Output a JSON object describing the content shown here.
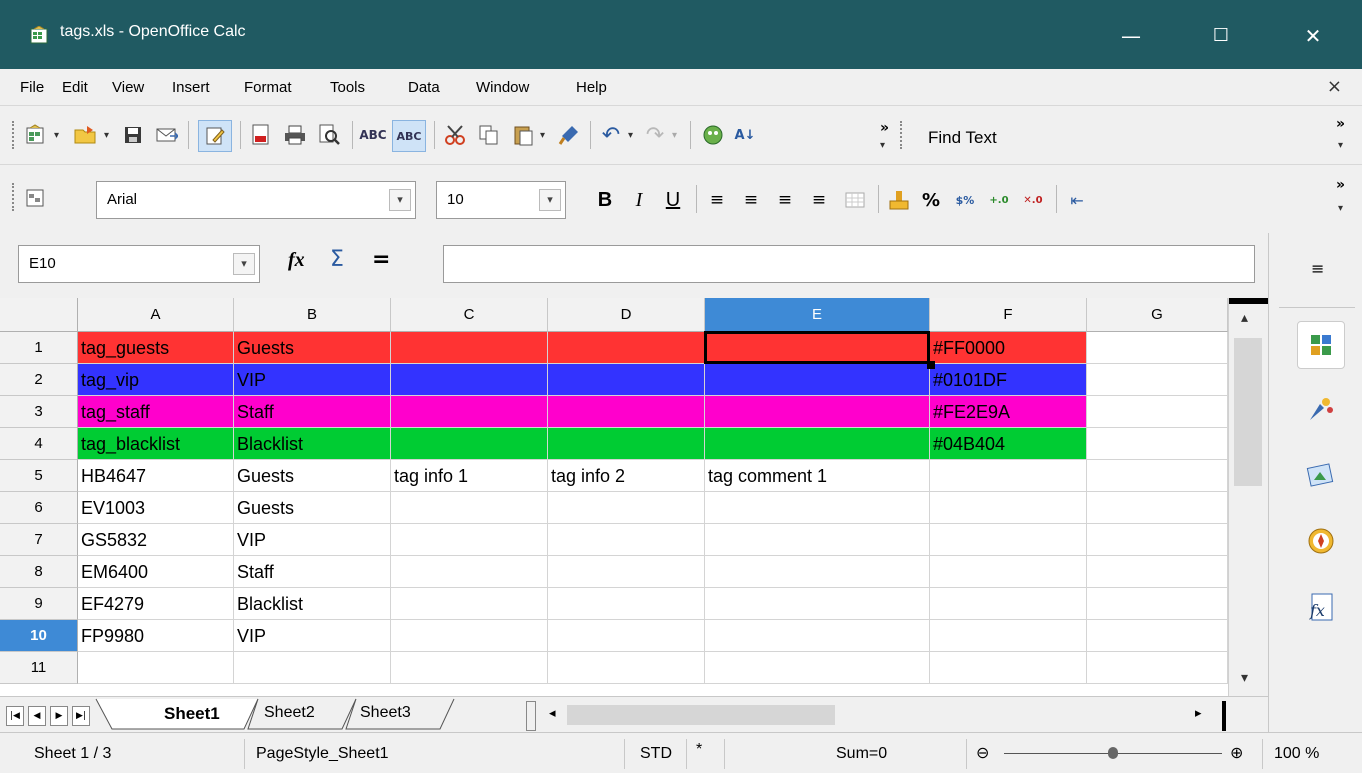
{
  "window": {
    "title": "tags.xls - OpenOffice Calc",
    "minimize": "—",
    "maximize": "☐",
    "close": "✕"
  },
  "menu": {
    "items": [
      "File",
      "Edit",
      "View",
      "Insert",
      "Format",
      "Tools",
      "Data",
      "Window",
      "Help"
    ],
    "close_doc": "×"
  },
  "toolbar": {
    "find_text": "Find Text",
    "more": "»"
  },
  "format": {
    "font_name": "Arial",
    "font_size": "10",
    "bold": "B",
    "italic": "I",
    "underline": "U",
    "percent": "%"
  },
  "formula": {
    "cell_ref": "E10",
    "fx": "fx",
    "sum": "Σ",
    "equals": "=",
    "content": ""
  },
  "grid": {
    "columns": [
      "A",
      "B",
      "C",
      "D",
      "E",
      "F",
      "G"
    ],
    "selected_column": "E",
    "rows": [
      {
        "num": "1",
        "fill": "#FF3333",
        "cells": [
          "tag_guests",
          "Guests",
          "",
          "",
          "",
          "#FF0000",
          ""
        ]
      },
      {
        "num": "2",
        "fill": "#3333FF",
        "cells": [
          "tag_vip",
          "VIP",
          "",
          "",
          "",
          "#0101DF",
          ""
        ]
      },
      {
        "num": "3",
        "fill": "#FF00CC",
        "cells": [
          "tag_staff",
          "Staff",
          "",
          "",
          "",
          "#FE2E9A",
          ""
        ]
      },
      {
        "num": "4",
        "fill": "#00CC33",
        "cells": [
          "tag_blacklist",
          "Blacklist",
          "",
          "",
          "",
          "#04B404",
          ""
        ]
      },
      {
        "num": "5",
        "fill": "",
        "cells": [
          "HB4647",
          "Guests",
          "tag info 1",
          "tag info 2",
          "tag comment 1",
          "",
          ""
        ]
      },
      {
        "num": "6",
        "fill": "",
        "cells": [
          "EV1003",
          "Guests",
          "",
          "",
          "",
          "",
          ""
        ]
      },
      {
        "num": "7",
        "fill": "",
        "cells": [
          "GS5832",
          "VIP",
          "",
          "",
          "",
          "",
          ""
        ]
      },
      {
        "num": "8",
        "fill": "",
        "cells": [
          "EM6400",
          "Staff",
          "",
          "",
          "",
          "",
          ""
        ]
      },
      {
        "num": "9",
        "fill": "",
        "cells": [
          "EF4279",
          "Blacklist",
          "",
          "",
          "",
          "",
          ""
        ]
      },
      {
        "num": "10",
        "fill": "",
        "cells": [
          "FP9980",
          "VIP",
          "",
          "",
          "",
          "",
          ""
        ]
      },
      {
        "num": "11",
        "fill": "",
        "cells": [
          "",
          "",
          "",
          "",
          "",
          "",
          ""
        ]
      }
    ],
    "selected_row": "10"
  },
  "sheets": {
    "tabs": [
      "Sheet1",
      "Sheet2",
      "Sheet3"
    ],
    "active": "Sheet1"
  },
  "status": {
    "sheet": "Sheet 1 / 3",
    "page_style": "PageStyle_Sheet1",
    "mode": "STD",
    "modified": "*",
    "sum": "Sum=0",
    "zoom": "100 %",
    "zoom_fraction": 0.5
  },
  "colors": {
    "titlebar": "#205a62",
    "selection": "#3e8ad6"
  }
}
